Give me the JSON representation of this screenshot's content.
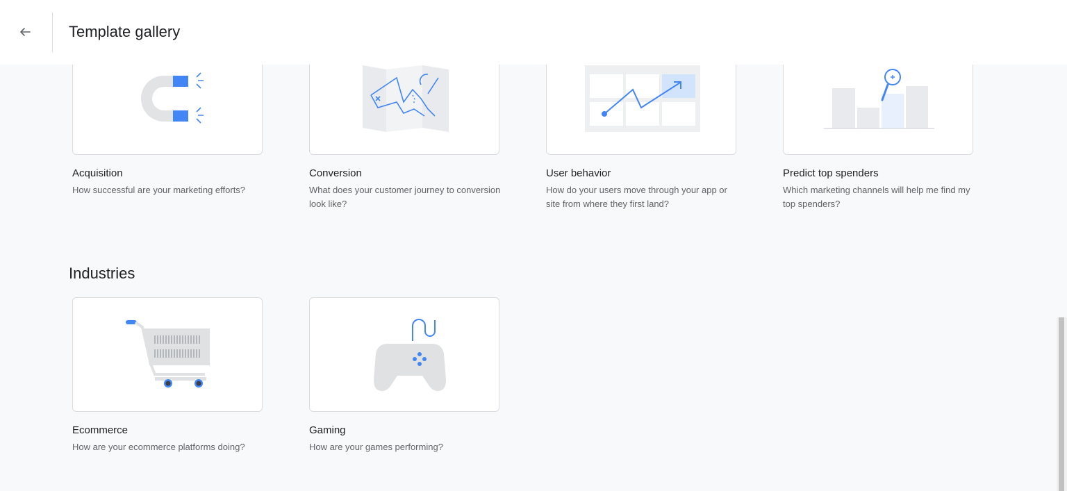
{
  "header": {
    "title": "Template gallery",
    "back_icon": "arrow-left-icon"
  },
  "sections": [
    {
      "title": "",
      "cards": [
        {
          "title": "Acquisition",
          "description": "How successful are your marketing efforts?",
          "icon": "magnet-icon"
        },
        {
          "title": "Conversion",
          "description": "What does your customer journey to conversion look like?",
          "icon": "map-icon"
        },
        {
          "title": "User behavior",
          "description": "How do your users move through your app or site from where they first land?",
          "icon": "trend-grid-icon"
        },
        {
          "title": "Predict top spenders",
          "description": "Which marketing channels will help me find my top spenders?",
          "icon": "bar-magnifier-icon"
        }
      ]
    },
    {
      "title": "Industries",
      "cards": [
        {
          "title": "Ecommerce",
          "description": "How are your ecommerce platforms doing?",
          "icon": "shopping-cart-icon"
        },
        {
          "title": "Gaming",
          "description": "How are your games performing?",
          "icon": "game-controller-icon"
        }
      ]
    }
  ],
  "colors": {
    "accent": "#4285f4",
    "background": "#f8f9fa",
    "illustration_gray": "#e8eaed"
  }
}
